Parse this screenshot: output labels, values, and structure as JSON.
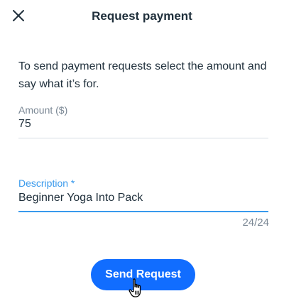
{
  "header": {
    "title": "Request payment",
    "close_icon": "close-icon"
  },
  "intro_text": "To send payment requests select the amount and say what it’s for.",
  "amount": {
    "label": "Amount ($)",
    "value": "75"
  },
  "description": {
    "label": "Description *",
    "value": "Beginner Yoga Into Pack",
    "counter": "24/24"
  },
  "send_button": {
    "label": "Send Request"
  },
  "colors": {
    "accent": "#3899ec",
    "button": "#116dff",
    "text": "#20303c",
    "muted": "#7a8794"
  },
  "cursor_icon": "hand-pointer-icon"
}
